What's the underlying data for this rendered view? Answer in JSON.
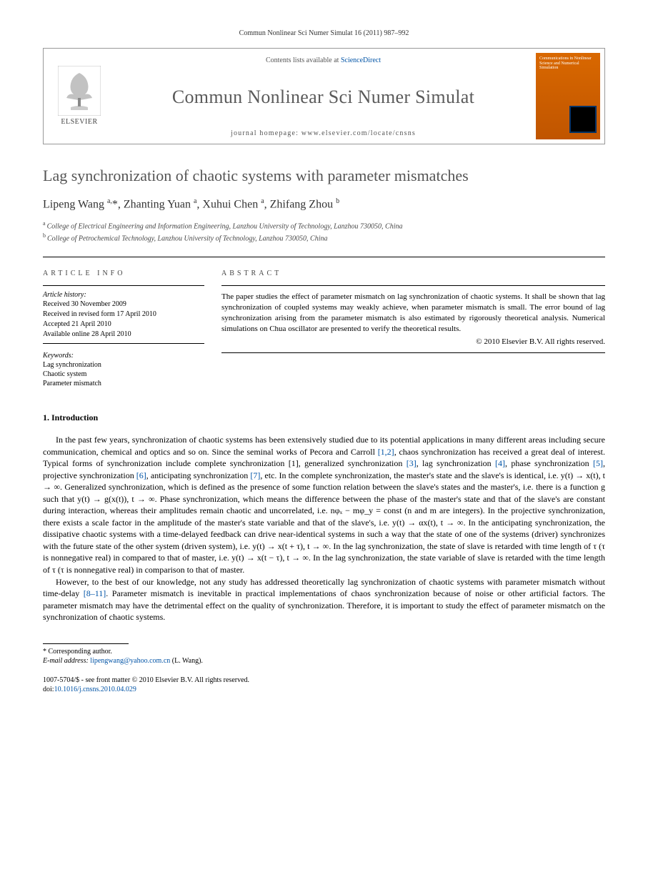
{
  "header_line": "Commun Nonlinear Sci Numer Simulat 16 (2011) 987–992",
  "publisher": "ELSEVIER",
  "contents_prefix": "Contents lists available at ",
  "contents_link": "ScienceDirect",
  "journal_name": "Commun Nonlinear Sci Numer Simulat",
  "homepage_label": "journal homepage: www.elsevier.com/locate/cnsns",
  "cover_title": "Communications in Nonlinear Science and Numerical Simulation",
  "title": "Lag synchronization of chaotic systems with parameter mismatches",
  "authors_html": "Lipeng Wang <sup>a,</sup>*, Zhanting Yuan <sup>a</sup>, Xuhui Chen <sup>a</sup>, Zhifang Zhou <sup>b</sup>",
  "affiliations": [
    {
      "mark": "a",
      "text": "College of Electrical Engineering and Information Engineering, Lanzhou University of Technology, Lanzhou 730050, China"
    },
    {
      "mark": "b",
      "text": "College of Petrochemical Technology, Lanzhou University of Technology, Lanzhou 730050, China"
    }
  ],
  "article_info_heading": "ARTICLE INFO",
  "abstract_heading": "ABSTRACT",
  "history_label": "Article history:",
  "history": [
    "Received 30 November 2009",
    "Received in revised form 17 April 2010",
    "Accepted 21 April 2010",
    "Available online 28 April 2010"
  ],
  "keywords_label": "Keywords:",
  "keywords": [
    "Lag synchronization",
    "Chaotic system",
    "Parameter mismatch"
  ],
  "abstract": "The paper studies the effect of parameter mismatch on lag synchronization of chaotic systems. It shall be shown that lag synchronization of coupled systems may weakly achieve, when parameter mismatch is small. The error bound of lag synchronization arising from the parameter mismatch is also estimated by rigorously theoretical analysis. Numerical simulations on Chua oscillator are presented to verify the theoretical results.",
  "copyright": "© 2010 Elsevier B.V. All rights reserved.",
  "intro_heading": "1. Introduction",
  "intro_p1": "In the past few years, synchronization of chaotic systems has been extensively studied due to its potential applications in many different areas including secure communication, chemical and optics and so on. Since the seminal works of Pecora and Carroll [1,2], chaos synchronization has received a great deal of interest. Typical forms of synchronization include complete synchronization [1], generalized synchronization [3], lag synchronization [4], phase synchronization [5], projective synchronization [6], anticipating synchronization [7], etc. In the complete synchronization, the master's state and the slave's is identical, i.e. y(t) → x(t), t → ∞. Generalized synchronization, which is defined as the presence of some function relation between the slave's states and the master's, i.e. there is a function g such that y(t) → g(x(t)), t → ∞. Phase synchronization, which means the difference between the phase of the master's state and that of the slave's are constant during interaction, whereas their amplitudes remain chaotic and uncorrelated, i.e. nφₓ − mφ_y = const (n and m are integers). In the projective synchronization, there exists a scale factor in the amplitude of the master's state variable and that of the slave's, i.e. y(t) → αx(t), t → ∞. In the anticipating synchronization, the dissipative chaotic systems with a time-delayed feedback can drive near-identical systems in such a way that the state of one of the systems (driver) synchronizes with the future state of the other system (driven system), i.e. y(t) → x(t + τ), t → ∞. In the lag synchronization, the state of slave is retarded with time length of τ (τ is nonnegative real) in compared to that of master, i.e. y(t) → x(t − τ), t → ∞. In the lag synchronization, the state variable of slave is retarded with the time length of τ (τ is nonnegative real) in comparison to that of master.",
  "intro_p2": "However, to the best of our knowledge, not any study has addressed theoretically lag synchronization of chaotic systems with parameter mismatch without time-delay [8–11]. Parameter mismatch is inevitable in practical implementations of chaos synchronization because of noise or other artificial factors. The parameter mismatch may have the detrimental effect on the quality of synchronization. Therefore, it is important to study the effect of parameter mismatch on the synchronization of chaotic systems.",
  "corr_label": "* Corresponding author.",
  "email_label": "E-mail address:",
  "email": "lipengwang@yahoo.com.cn",
  "email_suffix": "(L. Wang).",
  "footer_line1": "1007-5704/$ - see front matter © 2010 Elsevier B.V. All rights reserved.",
  "doi_label": "doi:",
  "doi": "10.1016/j.cnsns.2010.04.029",
  "refs": {
    "r12": "[1,2]",
    "r1": "[1]",
    "r3": "[3]",
    "r4": "[4]",
    "r5": "[5]",
    "r6": "[6]",
    "r7": "[7]",
    "r811": "[8–11]"
  }
}
